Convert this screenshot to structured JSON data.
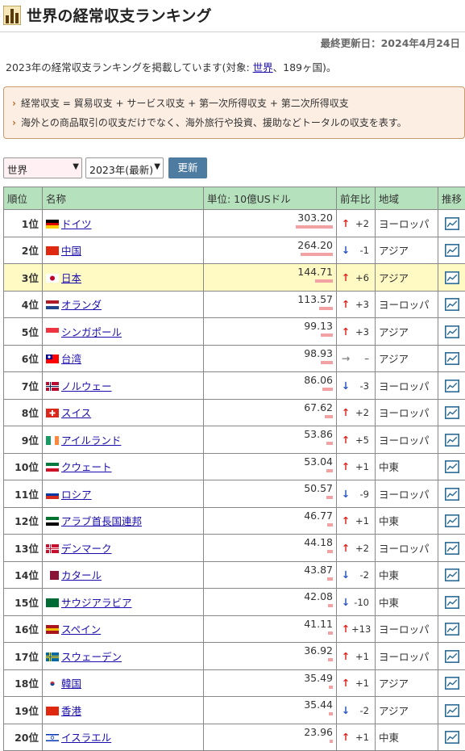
{
  "header": {
    "title": "世界の経常収支ランキング",
    "logo_icon": "bar-chart-logo-icon"
  },
  "updated": "最終更新日：2024年4月24日",
  "intro": {
    "prefix": "2023年の経常収支ランキングを掲載しています(対象: ",
    "link": "世界",
    "suffix": "、189ヶ国)。"
  },
  "notes": [
    "経常収支 = 貿易収支 + サービス収支 + 第一次所得収支 + 第二次所得収支",
    "海外との商品取引の収支だけでなく、海外旅行や投資、援助などトータルの収支を表す。"
  ],
  "controls": {
    "region": "世界",
    "year": "2023年(最新)",
    "update_label": "更新"
  },
  "table": {
    "headers": {
      "rank": "順位",
      "name": "名称",
      "unit": "単位: 10億USドル",
      "change": "前年比",
      "region": "地域",
      "trend": "推移"
    },
    "rows": [
      {
        "rank": "1位",
        "name": "ドイツ",
        "value": "303.20",
        "num": 303.2,
        "dir": "up",
        "delta": "+2",
        "region": "ヨーロッパ",
        "flag": [
          "#000000",
          "#dd0000",
          "#ffce00"
        ],
        "flag_dir": "h"
      },
      {
        "rank": "2位",
        "name": "中国",
        "value": "264.20",
        "num": 264.2,
        "dir": "down",
        "delta": "-1",
        "region": "アジア",
        "flag": [
          "#de2910",
          "#de2910",
          "#de2910"
        ],
        "flag_dir": "h"
      },
      {
        "rank": "3位",
        "name": "日本",
        "value": "144.71",
        "num": 144.71,
        "dir": "up",
        "delta": "+6",
        "region": "アジア",
        "flag": [
          "#ffffff",
          "#ffffff",
          "#ffffff"
        ],
        "flag_dir": "jp",
        "highlight": true
      },
      {
        "rank": "4位",
        "name": "オランダ",
        "value": "113.57",
        "num": 113.57,
        "dir": "up",
        "delta": "+3",
        "region": "ヨーロッパ",
        "flag": [
          "#ae1c28",
          "#ffffff",
          "#21468b"
        ],
        "flag_dir": "h"
      },
      {
        "rank": "5位",
        "name": "シンガポール",
        "value": "99.13",
        "num": 99.13,
        "dir": "up",
        "delta": "+3",
        "region": "アジア",
        "flag": [
          "#ef3340",
          "#ffffff",
          "#ffffff"
        ],
        "flag_dir": "h2"
      },
      {
        "rank": "6位",
        "name": "台湾",
        "value": "98.93",
        "num": 98.93,
        "dir": "flat",
        "delta": "–",
        "region": "アジア",
        "flag": [
          "#000095",
          "#fe0000",
          "#fe0000"
        ],
        "flag_dir": "tw"
      },
      {
        "rank": "7位",
        "name": "ノルウェー",
        "value": "86.06",
        "num": 86.06,
        "dir": "down",
        "delta": "-3",
        "region": "ヨーロッパ",
        "flag": [
          "#ba0c2f",
          "#ffffff",
          "#00205b"
        ],
        "flag_dir": "cross"
      },
      {
        "rank": "8位",
        "name": "スイス",
        "value": "67.62",
        "num": 67.62,
        "dir": "up",
        "delta": "+2",
        "region": "ヨーロッパ",
        "flag": [
          "#da291c",
          "#ffffff",
          "#da291c"
        ],
        "flag_dir": "ch"
      },
      {
        "rank": "9位",
        "name": "アイルランド",
        "value": "53.86",
        "num": 53.86,
        "dir": "up",
        "delta": "+5",
        "region": "ヨーロッパ",
        "flag": [
          "#169b62",
          "#ffffff",
          "#ff883e"
        ],
        "flag_dir": "v"
      },
      {
        "rank": "10位",
        "name": "クウェート",
        "value": "53.04",
        "num": 53.04,
        "dir": "up",
        "delta": "+1",
        "region": "中東",
        "flag": [
          "#007a3d",
          "#ffffff",
          "#ce1126"
        ],
        "flag_dir": "h"
      },
      {
        "rank": "11位",
        "name": "ロシア",
        "value": "50.57",
        "num": 50.57,
        "dir": "down",
        "delta": "-9",
        "region": "ヨーロッパ",
        "flag": [
          "#ffffff",
          "#0039a6",
          "#d52b1e"
        ],
        "flag_dir": "h"
      },
      {
        "rank": "12位",
        "name": "アラブ首長国連邦",
        "value": "46.77",
        "num": 46.77,
        "dir": "up",
        "delta": "+1",
        "region": "中東",
        "flag": [
          "#00732f",
          "#ffffff",
          "#000000"
        ],
        "flag_dir": "h"
      },
      {
        "rank": "13位",
        "name": "デンマーク",
        "value": "44.18",
        "num": 44.18,
        "dir": "up",
        "delta": "+2",
        "region": "ヨーロッパ",
        "flag": [
          "#c8102e",
          "#ffffff",
          "#c8102e"
        ],
        "flag_dir": "cross"
      },
      {
        "rank": "14位",
        "name": "カタール",
        "value": "43.87",
        "num": 43.87,
        "dir": "down",
        "delta": "-2",
        "region": "中東",
        "flag": [
          "#ffffff",
          "#8a1538",
          "#8a1538"
        ],
        "flag_dir": "v2"
      },
      {
        "rank": "15位",
        "name": "サウジアラビア",
        "value": "42.08",
        "num": 42.08,
        "dir": "down",
        "delta": "-10",
        "region": "中東",
        "flag": [
          "#006c35",
          "#006c35",
          "#006c35"
        ],
        "flag_dir": "h"
      },
      {
        "rank": "16位",
        "name": "スペイン",
        "value": "41.11",
        "num": 41.11,
        "dir": "up",
        "delta": "+13",
        "region": "ヨーロッパ",
        "flag": [
          "#aa151b",
          "#f1bf00",
          "#aa151b"
        ],
        "flag_dir": "h"
      },
      {
        "rank": "17位",
        "name": "スウェーデン",
        "value": "36.92",
        "num": 36.92,
        "dir": "up",
        "delta": "+1",
        "region": "ヨーロッパ",
        "flag": [
          "#006aa7",
          "#fecc00",
          "#006aa7"
        ],
        "flag_dir": "cross"
      },
      {
        "rank": "18位",
        "name": "韓国",
        "value": "35.49",
        "num": 35.49,
        "dir": "up",
        "delta": "+1",
        "region": "アジア",
        "flag": [
          "#ffffff",
          "#cd2e3a",
          "#0047a0"
        ],
        "flag_dir": "kr"
      },
      {
        "rank": "19位",
        "name": "香港",
        "value": "35.44",
        "num": 35.44,
        "dir": "down",
        "delta": "-2",
        "region": "アジア",
        "flag": [
          "#de2910",
          "#de2910",
          "#de2910"
        ],
        "flag_dir": "h"
      },
      {
        "rank": "20位",
        "name": "イスラエル",
        "value": "23.96",
        "num": 23.96,
        "dir": "up",
        "delta": "+1",
        "region": "中東",
        "flag": [
          "#ffffff",
          "#0038b8",
          "#ffffff"
        ],
        "flag_dir": "il"
      }
    ]
  }
}
